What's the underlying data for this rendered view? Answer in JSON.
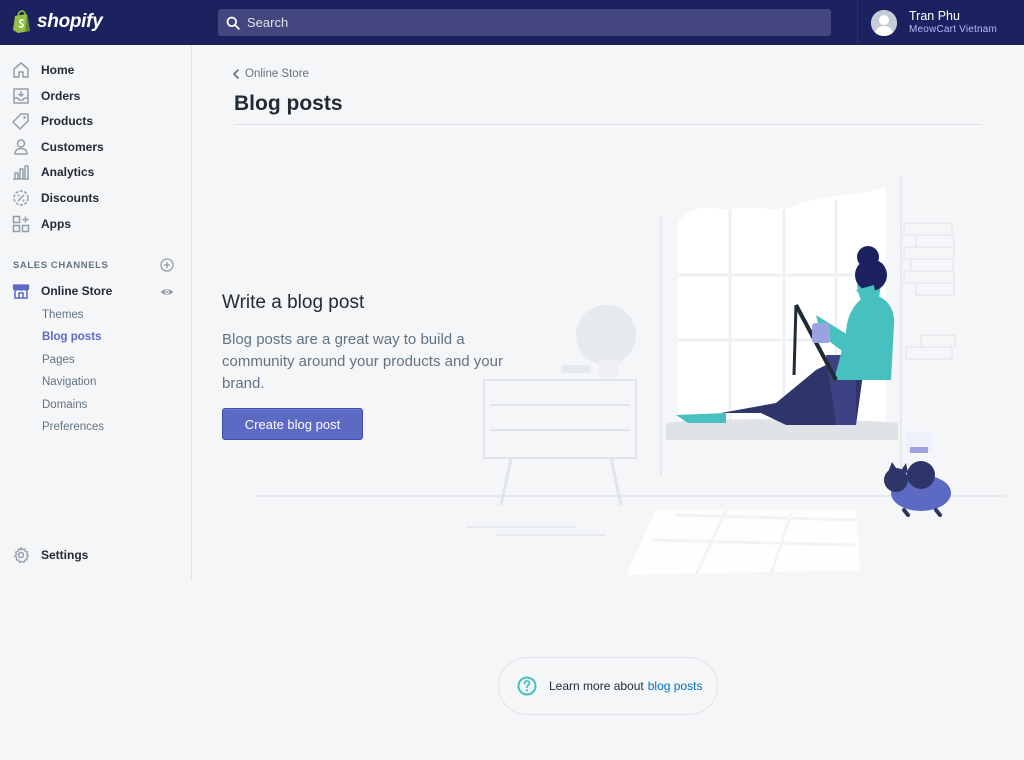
{
  "brand": {
    "name": "shopify",
    "accent": "#5c6ac4",
    "topbar_color": "#1c2260"
  },
  "search": {
    "placeholder": "Search",
    "icon": "search-icon"
  },
  "user": {
    "name": "Tran Phu",
    "store": "MeowCart Vietnam"
  },
  "sidebar": {
    "items": [
      {
        "label": "Home",
        "icon": "home-icon"
      },
      {
        "label": "Orders",
        "icon": "orders-icon"
      },
      {
        "label": "Products",
        "icon": "tag-icon"
      },
      {
        "label": "Customers",
        "icon": "person-icon"
      },
      {
        "label": "Analytics",
        "icon": "bar-chart-icon"
      },
      {
        "label": "Discounts",
        "icon": "discount-icon"
      },
      {
        "label": "Apps",
        "icon": "apps-icon"
      }
    ],
    "sales_channels_title": "SALES CHANNELS",
    "online_store": {
      "label": "Online Store",
      "icon": "store-icon"
    },
    "sub_items": [
      "Themes",
      "Blog posts",
      "Pages",
      "Navigation",
      "Domains",
      "Preferences"
    ],
    "active_sub_item": "Blog posts",
    "settings": {
      "label": "Settings",
      "icon": "gear-icon"
    }
  },
  "page": {
    "breadcrumb": "Online Store",
    "title": "Blog posts"
  },
  "empty_state": {
    "heading": "Write a blog post",
    "text": "Blog posts are a great way to build a community around your products and your brand.",
    "button": "Create blog post"
  },
  "help": {
    "text": "Learn more about",
    "link": "blog posts"
  }
}
